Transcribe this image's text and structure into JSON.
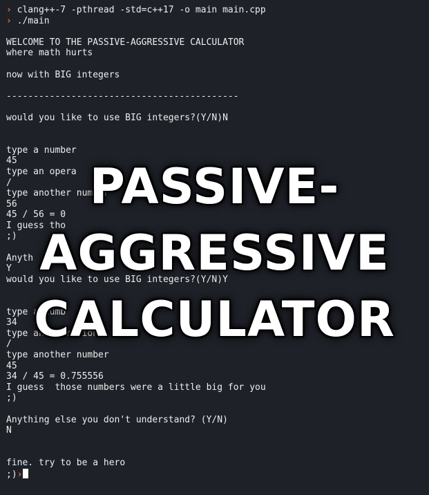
{
  "terminal": {
    "prompt_symbol": "›",
    "lines": [
      {
        "prompt": true,
        "text": "clang++-7 -pthread -std=c++17 -o main main.cpp"
      },
      {
        "prompt": true,
        "text": "./main"
      },
      {
        "text": ""
      },
      {
        "text": "WELCOME TO THE PASSIVE-AGGRESSIVE CALCULATOR"
      },
      {
        "text": "where math hurts"
      },
      {
        "text": ""
      },
      {
        "text": "now with BIG integers"
      },
      {
        "text": ""
      },
      {
        "text": "-------------------------------------------"
      },
      {
        "text": ""
      },
      {
        "text": "would you like to use BIG integers?(Y/N)N"
      },
      {
        "text": ""
      },
      {
        "text": ""
      },
      {
        "text": "type a number"
      },
      {
        "text": "45"
      },
      {
        "text": "type an opera"
      },
      {
        "text": "/"
      },
      {
        "text": "type another number"
      },
      {
        "text": "56"
      },
      {
        "text": "45 / 56 = 0"
      },
      {
        "text": "I guess tho"
      },
      {
        "text": ";)"
      },
      {
        "text": ""
      },
      {
        "text": "Anyth"
      },
      {
        "text": "Y"
      },
      {
        "text": "would you like to use BIG integers?(Y/N)Y"
      },
      {
        "text": ""
      },
      {
        "text": ""
      },
      {
        "text": "type a numb"
      },
      {
        "text": "34"
      },
      {
        "text": "type an operation"
      },
      {
        "text": "/"
      },
      {
        "text": "type another number"
      },
      {
        "text": "45"
      },
      {
        "text": "34 / 45 = 0.755556"
      },
      {
        "text": "I guess  those numbers were a little big for you"
      },
      {
        "text": ";)"
      },
      {
        "text": ""
      },
      {
        "text": "Anything else you don't understand? (Y/N)"
      },
      {
        "text": "N"
      },
      {
        "text": ""
      },
      {
        "text": ""
      },
      {
        "text": "fine. try to be a hero"
      }
    ],
    "final_line": {
      "text": ";)",
      "prompt_after": "›"
    }
  },
  "overlay": {
    "lines": [
      "PASSIVE-",
      "AGGRESSIVE",
      "CALCULATOR"
    ]
  },
  "colors": {
    "background": "#1e2128",
    "text": "#eeeeee",
    "prompt": "#e8703a",
    "overlay": "#ffffff"
  }
}
